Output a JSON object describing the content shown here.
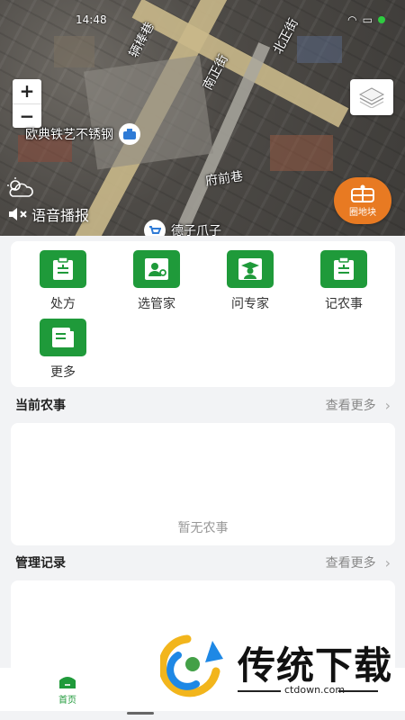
{
  "status_bar": {
    "time": "14:48"
  },
  "map": {
    "streets": [
      "北正街",
      "南正街",
      "府前巷",
      "辆棒巷"
    ],
    "zoom_in": "+",
    "zoom_out": "−",
    "poi_1": "欧典铁艺不锈钢",
    "poi_2": "德子爪子",
    "voice_label": "语音播报",
    "plot_button_label": "圈地块",
    "icons": [
      "layers-icon",
      "weather-icon",
      "speaker-mute-icon",
      "plot-icon"
    ]
  },
  "actions": [
    {
      "label": "处方",
      "icon": "prescription-icon"
    },
    {
      "label": "选管家",
      "icon": "manager-icon"
    },
    {
      "label": "问专家",
      "icon": "expert-icon"
    },
    {
      "label": "记农事",
      "icon": "farm-record-icon"
    },
    {
      "label": "更多",
      "icon": "more-icon"
    }
  ],
  "current_farming": {
    "title": "当前农事",
    "more": "查看更多",
    "empty": "暂无农事"
  },
  "management_records": {
    "title": "管理记录",
    "more": "查看更多"
  },
  "tabbar": {
    "home_label": "首页"
  },
  "watermark": {
    "title": "传统下载",
    "url": "ctdown.com"
  },
  "colors": {
    "brand_green": "#1f9a3a",
    "plot_orange": "#e87a22"
  }
}
